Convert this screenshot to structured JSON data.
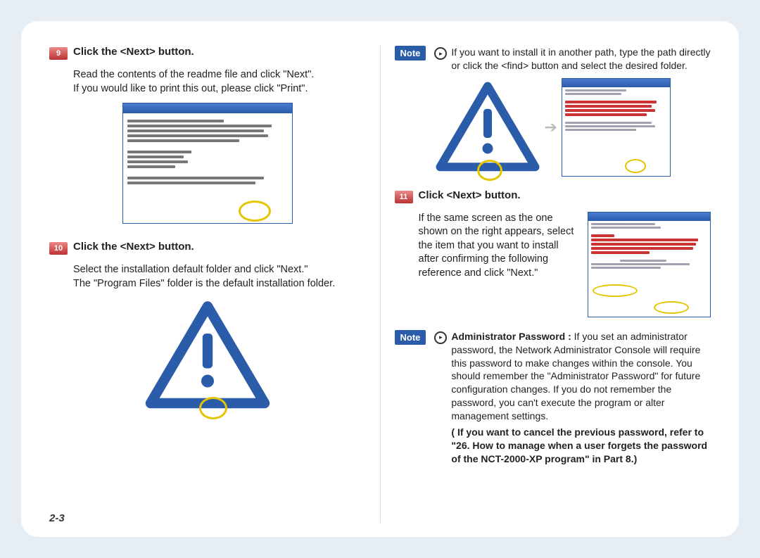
{
  "pageNumber": "2-3",
  "left": {
    "step9": {
      "num": "9",
      "head": "Click the <Next> button.",
      "body1": "Read the contents of the readme file and click \"Next\".",
      "body2": "If you would like to print this out, please click \"Print\"."
    },
    "step10": {
      "num": "10",
      "head": "Click the <Next> button.",
      "body1": "Select the installation default folder and click \"Next.\"",
      "body2": "The \"Program Files\" folder is the default installation folder."
    }
  },
  "right": {
    "note1": {
      "label": "Note",
      "text": "If you want to install it in another path, type the path directly or click the <find> button and select the desired folder."
    },
    "step11": {
      "num": "11",
      "head": "Click <Next> button.",
      "body": "If the same screen as the one shown on the right appears, select the item that you want to install after confirming the following reference and click \"Next.\""
    },
    "note2": {
      "label": "Note",
      "boldLead": "Administrator Password : ",
      "body": "If you set an administrator password, the Network Administrator Console will require this password to make changes within the console. You should remember the \"Administrator Password\" for future configuration changes. If you do not remember the password, you can't execute the program or alter management settings.",
      "ref": "( If you want to cancel the previous password, refer to \"26. How to manage when a user forgets the password of the NCT-2000-XP program\" in Part 8.)"
    }
  }
}
